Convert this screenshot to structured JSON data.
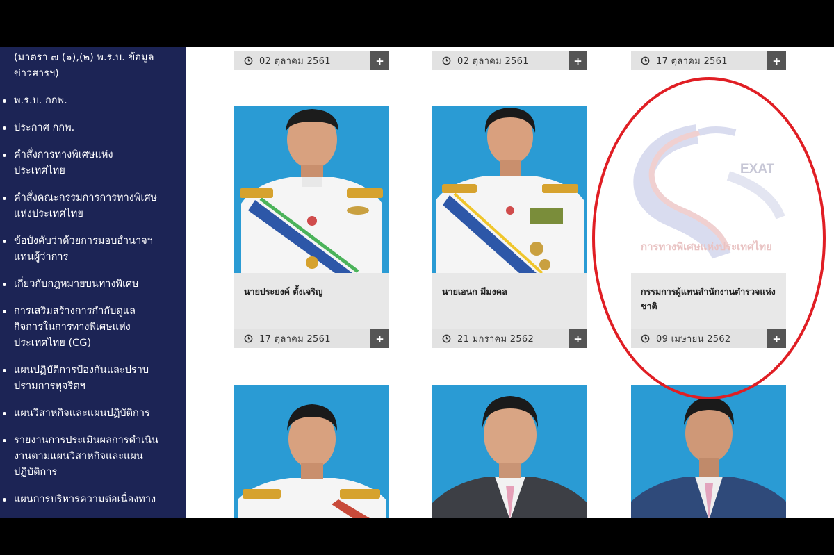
{
  "sidebar": {
    "top_continuation": "(มาตรา ๗ (๑),(๒) พ.ร.บ. ข้อมูลข่าวสารฯ)",
    "items": [
      {
        "label": "พ.ร.บ. กกพ."
      },
      {
        "label": "ประกาศ กกพ."
      },
      {
        "label": "คำสั่งการทางพิเศษแห่งประเทศไทย"
      },
      {
        "label": "คำสั่งคณะกรรมการการทางพิเศษแห่งประเทศไทย"
      },
      {
        "label": "ข้อบังคับว่าด้วยการมอบอำนาจฯ แทนผู้ว่าการ"
      },
      {
        "label": "เกี่ยวกับกฎหมายบนทางพิเศษ"
      },
      {
        "label": "การเสริมสร้างการกำกับดูแลกิจการในการทางพิเศษแห่งประเทศไทย (CG)"
      },
      {
        "label": "แผนปฏิบัติการป้องกันและปราบปรามการทุจริตฯ"
      },
      {
        "label": "แผนวิสาหกิจและแผนปฏิบัติการ"
      },
      {
        "label": "รายงานการประเมินผลการดำเนินงานตามแผนวิสาหกิจและแผนปฏิบัติการ"
      },
      {
        "label": "แผนการบริหารความต่อเนื่องทาง"
      }
    ]
  },
  "top_row_dates": [
    "02 ตุลาคม 2561",
    "02 ตุลาคม 2561",
    "17 ตุลาคม 2561"
  ],
  "cards": [
    {
      "name": "นายประยงค์ ตั้งเจริญ",
      "date": "17 ตุลาคม 2561"
    },
    {
      "name": "นายเอนก มีมงคล",
      "date": "21 มกราคม 2562"
    },
    {
      "name": "กรรมการผู้แทนสำนักงานตำรวจแห่งชาติ",
      "date": "09 เมษายน 2562"
    }
  ],
  "placeholder_logo": {
    "word": "EXAT",
    "subtitle": "การทางพิเศษแห่งประเทศไทย"
  },
  "plus_label": "+",
  "colors": {
    "sidebar_bg": "#1c2455",
    "photo_bg": "#2a9bd4",
    "highlight_oval": "#e01e24",
    "button_bg": "#555555"
  },
  "icons": {
    "date": "clock-icon",
    "more": "plus-icon"
  }
}
